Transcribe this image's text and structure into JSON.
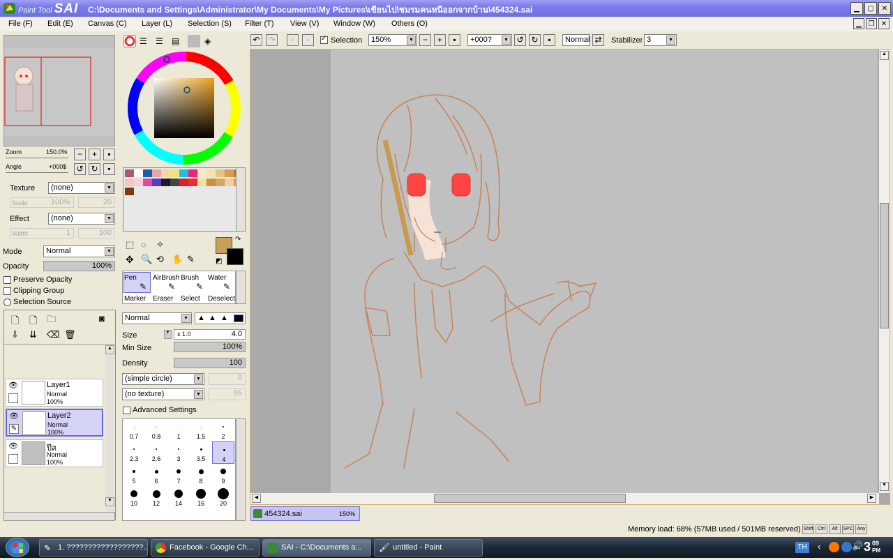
{
  "window": {
    "app_name_small": "Paint Tool",
    "app_name_big": "SAI",
    "title_path": "C:\\Documents and Settings\\Administrator\\My Documents\\My Pictures\\เขียนไป\\ชมรมคนหนีออกจากบ้าน\\454324.sai"
  },
  "menu": [
    "File (F)",
    "Edit (E)",
    "Canvas (C)",
    "Layer (L)",
    "Selection (S)",
    "Filter (T)",
    "View (V)",
    "Window (W)",
    "Others (O)"
  ],
  "navigator": {
    "zoom_label": "Zoom",
    "zoom_value": "150.0%",
    "angle_label": "Angle",
    "angle_value": "+000$"
  },
  "layer_props": {
    "texture_label": "Texture",
    "texture_value": "(none)",
    "scale_label": "Scale",
    "scale_value": "100%",
    "scale_num": "20",
    "effect_label": "Effect",
    "effect_value": "(none)",
    "width_label": "Width",
    "width_value": "1",
    "width_num": "100",
    "mode_label": "Mode",
    "mode_value": "Normal",
    "opacity_label": "Opacity",
    "opacity_value": "100%",
    "preserve_opacity": "Preserve Opacity",
    "clipping_group": "Clipping Group",
    "selection_source": "Selection Source"
  },
  "layers": [
    {
      "name": "Layer1",
      "mode": "Normal",
      "opacity": "100%",
      "selected": false
    },
    {
      "name": "Layer2",
      "mode": "Normal",
      "opacity": "100%",
      "selected": true
    },
    {
      "name": "ป๊ส",
      "mode": "Normal",
      "opacity": "100%",
      "selected": false
    }
  ],
  "colors": {
    "primary": "#c8a05a",
    "secondary": "#000000",
    "accent": "#6c6ce0"
  },
  "tools": [
    "Pen",
    "AirBrush",
    "Brush",
    "Water",
    "Marker",
    "Eraser",
    "Select",
    "Deselect"
  ],
  "brush": {
    "mode_value": "Normal",
    "size_label": "Size",
    "size_mult": "x 1.0",
    "size_value": "4.0",
    "min_size_label": "Min Size",
    "min_size_value": "100%",
    "density_label": "Density",
    "density_value": "100",
    "shape_value": "(simple circle)",
    "shape_num": "0",
    "texture_value": "(no texture)",
    "texture_num": "95",
    "advanced_label": "Advanced Settings",
    "sizes": [
      "0.7",
      "0.8",
      "1",
      "1.5",
      "2",
      "2.3",
      "2.6",
      "3",
      "3.5",
      "4",
      "5",
      "6",
      "7",
      "8",
      "9",
      "10",
      "12",
      "14",
      "16",
      "20"
    ],
    "selected_size": "4"
  },
  "toolbar": {
    "selection_label": "Selection",
    "zoom_value": "150%",
    "angle_value": "+000?",
    "blend_value": "Normal",
    "stabilizer_label": "Stabilizer",
    "stabilizer_value": "3"
  },
  "canvas_tab": {
    "file": "454324.sai",
    "zoom": "150%"
  },
  "status": {
    "memory": "Memory load: 68% (57MB used / 501MB reserved)",
    "keys": [
      "Shift",
      "Ctrl",
      "Alt",
      "SPC",
      "Any"
    ]
  },
  "taskbar": {
    "items": [
      "1. ??????????????????...",
      "Facebook - Google Ch...",
      "SAI - C:\\Documents a...",
      "untitled - Paint"
    ],
    "lang": "TH",
    "clock_hour": "3",
    "clock_min": "09",
    "clock_ampm": "PM"
  }
}
